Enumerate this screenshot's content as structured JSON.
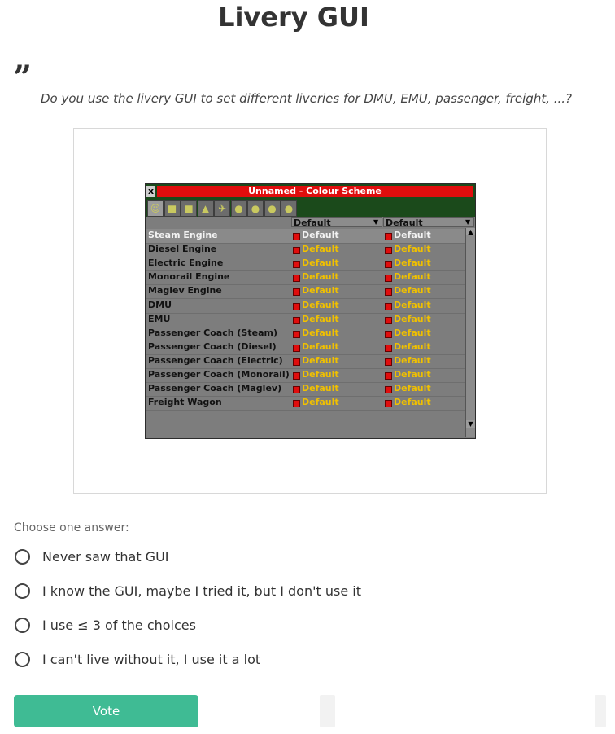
{
  "poll": {
    "title": "Livery GUI",
    "quote_mark": "”",
    "question": "Do you use the livery GUI to set different liveries for DMU, EMU, passenger, freight, ...?",
    "choose_label": "Choose one answer:",
    "options": [
      "Never saw that GUI",
      "I know the GUI, maybe I tried it, but I don't use it",
      "I use ≤ 3 of the choices",
      "I can't live without it, I use it a lot"
    ],
    "vote_label": "Vote"
  },
  "game_window": {
    "close_glyph": "x",
    "title": "Unnamed - Colour Scheme",
    "tabs": [
      {
        "icon": "company-manager-icon",
        "glyph": "☺"
      },
      {
        "icon": "train-icon",
        "glyph": "■"
      },
      {
        "icon": "road-vehicle-icon",
        "glyph": "■"
      },
      {
        "icon": "ship-icon",
        "glyph": "▲"
      },
      {
        "icon": "aircraft-icon",
        "glyph": "✈"
      },
      {
        "icon": "group-icon-1",
        "glyph": "●"
      },
      {
        "icon": "group-icon-2",
        "glyph": "●"
      },
      {
        "icon": "group-icon-3",
        "glyph": "●"
      },
      {
        "icon": "group-icon-4",
        "glyph": "●"
      }
    ],
    "header_primary": "Default",
    "header_secondary": "Default",
    "swatch_color": "#e00d0d",
    "rows": [
      {
        "name": "Steam Engine",
        "primary": "Default",
        "secondary": "Default"
      },
      {
        "name": "Diesel Engine",
        "primary": "Default",
        "secondary": "Default"
      },
      {
        "name": "Electric Engine",
        "primary": "Default",
        "secondary": "Default"
      },
      {
        "name": "Monorail Engine",
        "primary": "Default",
        "secondary": "Default"
      },
      {
        "name": "Maglev Engine",
        "primary": "Default",
        "secondary": "Default"
      },
      {
        "name": "DMU",
        "primary": "Default",
        "secondary": "Default"
      },
      {
        "name": "EMU",
        "primary": "Default",
        "secondary": "Default"
      },
      {
        "name": "Passenger Coach (Steam)",
        "primary": "Default",
        "secondary": "Default"
      },
      {
        "name": "Passenger Coach (Diesel)",
        "primary": "Default",
        "secondary": "Default"
      },
      {
        "name": "Passenger Coach (Electric)",
        "primary": "Default",
        "secondary": "Default"
      },
      {
        "name": "Passenger Coach (Monorail)",
        "primary": "Default",
        "secondary": "Default"
      },
      {
        "name": "Passenger Coach (Maglev)",
        "primary": "Default",
        "secondary": "Default"
      },
      {
        "name": "Freight Wagon",
        "primary": "Default",
        "secondary": "Default"
      }
    ]
  },
  "colors": {
    "vote_button": "#3fbb94",
    "window_title_bar": "#e00d0d",
    "value_text": "#f0c000"
  }
}
